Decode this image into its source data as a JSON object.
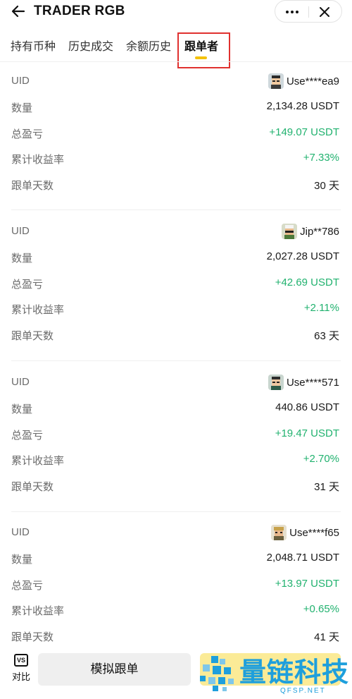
{
  "header": {
    "title": "TRADER RGB",
    "back_icon": "arrow-left-icon",
    "more_icon": "more-dots-icon",
    "close_icon": "close-icon"
  },
  "tabs": [
    {
      "label": "持有币种",
      "active": false
    },
    {
      "label": "历史成交",
      "active": false
    },
    {
      "label": "余额历史",
      "active": false
    },
    {
      "label": "跟单者",
      "active": true
    }
  ],
  "labels": {
    "uid": "UID",
    "amount": "数量",
    "total_pnl": "总盈亏",
    "cumulative_return": "累计收益率",
    "follow_days": "跟单天数"
  },
  "followers": [
    {
      "uid": "Use****ea9",
      "amount": "2,134.28 USDT",
      "total_pnl": "+149.07 USDT",
      "cumulative_return": "+7.33%",
      "follow_days": "30 天"
    },
    {
      "uid": "Jip**786",
      "amount": "2,027.28 USDT",
      "total_pnl": "+42.69 USDT",
      "cumulative_return": "+2.11%",
      "follow_days": "63 天"
    },
    {
      "uid": "Use****571",
      "amount": "440.86 USDT",
      "total_pnl": "+19.47 USDT",
      "cumulative_return": "+2.70%",
      "follow_days": "31 天"
    },
    {
      "uid": "Use****f65",
      "amount": "2,048.71 USDT",
      "total_pnl": "+13.97 USDT",
      "cumulative_return": "+0.65%",
      "follow_days": "41 天"
    }
  ],
  "bottom": {
    "compare_icon_text": "VS",
    "compare_label": "对比",
    "simulate_button": "模拟跟单",
    "follow_button": ""
  },
  "watermark": {
    "name": "量链科技",
    "domain": "QFSP.NET"
  },
  "colors": {
    "accent_yellow": "#f4c20d",
    "profit_green": "#21b26f",
    "highlight_red": "#e0312f",
    "watermark_blue": "#1e9fdc"
  }
}
